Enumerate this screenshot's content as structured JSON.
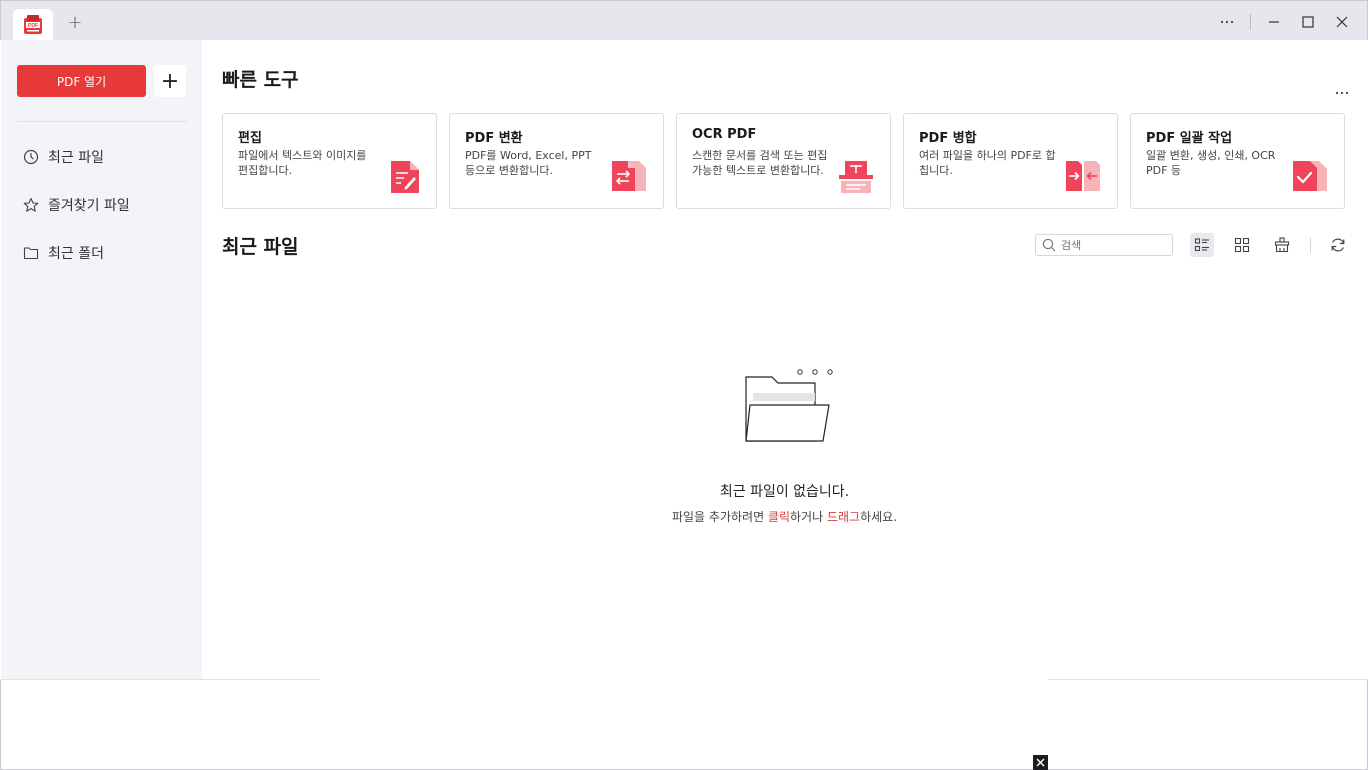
{
  "window": {
    "new_tab_symbol": "+",
    "controls": [
      "more",
      "minimize",
      "maximize",
      "close"
    ]
  },
  "sidebar": {
    "open_button": "PDF 열기",
    "add_button": "+",
    "items": [
      {
        "label": "최근 파일",
        "icon": "clock-icon"
      },
      {
        "label": "즐겨찾기 파일",
        "icon": "star-icon"
      },
      {
        "label": "최근 폴더",
        "icon": "folder-icon"
      }
    ]
  },
  "quick_tools": {
    "title": "빠른 도구",
    "more": "...",
    "cards": [
      {
        "title": "편집",
        "desc": "파일에서 텍스트와 이미지를 편집합니다.",
        "icon": "edit-doc-icon"
      },
      {
        "title": "PDF 변환",
        "desc": "PDF를 Word, Excel, PPT 등으로 변환합니다.",
        "icon": "convert-doc-icon"
      },
      {
        "title": "OCR PDF",
        "desc": "스캔한 문서를 검색 또는 편집 가능한 텍스트로 변환합니다.",
        "icon": "ocr-scanner-icon"
      },
      {
        "title": "PDF 병합",
        "desc": "여러 파일을 하나의 PDF로 합칩니다.",
        "icon": "merge-doc-icon"
      },
      {
        "title": "PDF 일괄 작업",
        "desc": "일괄 변환, 생성, 인쇄, OCR PDF 등",
        "icon": "batch-doc-icon"
      }
    ]
  },
  "recent": {
    "title": "최근 파일",
    "search_placeholder": "검색",
    "empty_title": "최근 파일이 없습니다.",
    "empty_sub_prefix": "파일을 추가하려면 ",
    "empty_click": "클릭",
    "empty_mid": "하거나 ",
    "empty_drag": "드래그",
    "empty_suffix": "하세요."
  },
  "colors": {
    "accent": "#e7393a",
    "sidebar_bg": "#f3f4f8",
    "titlebar_bg": "#e6e7ec",
    "icon_red": "#f0445a",
    "icon_pink": "#f7b4b8"
  }
}
